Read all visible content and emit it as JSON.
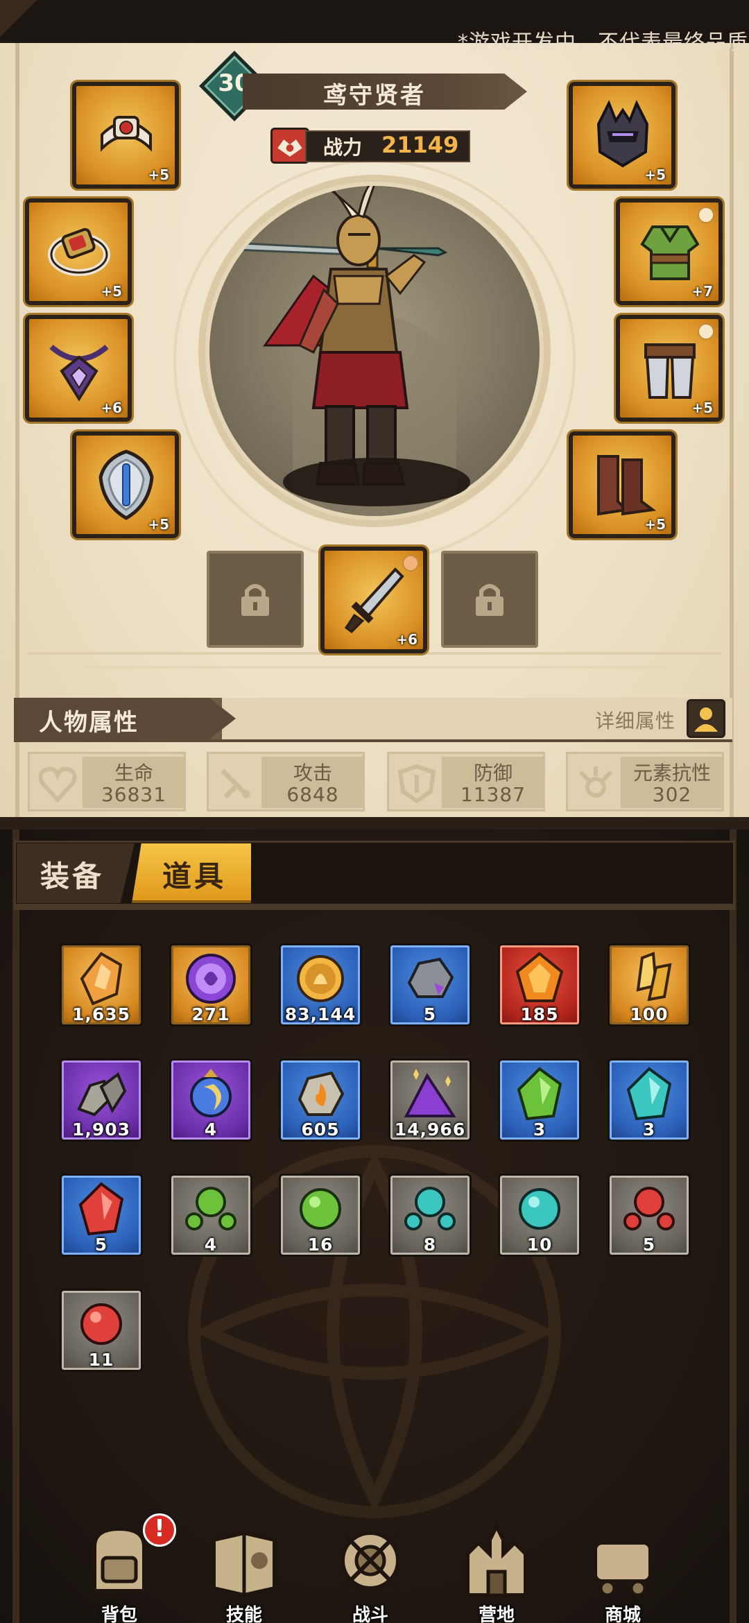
{
  "dev_note": "*游戏开发中，不代表最终品质",
  "hero": {
    "level": "30",
    "name": "鸢守贤者",
    "power_label": "战力",
    "power_value": "21149"
  },
  "equipment": {
    "ring_top": "+5",
    "ring_mid": "+5",
    "amulet": "+6",
    "shield": "+5",
    "helmet": "+5",
    "chest": "+7",
    "legs": "+5",
    "boots": "+5",
    "weapon": "+6"
  },
  "attributes": {
    "title": "人物属性",
    "detail_label": "详细属性",
    "stats": [
      {
        "label": "生命",
        "value": "36831",
        "icon": "heart-icon"
      },
      {
        "label": "攻击",
        "value": "6848",
        "icon": "sword-icon"
      },
      {
        "label": "防御",
        "value": "11387",
        "icon": "shield-icon"
      },
      {
        "label": "元素抗性",
        "value": "302",
        "icon": "element-icon"
      }
    ]
  },
  "tabs": {
    "equipment": "装备",
    "items": "道具"
  },
  "items": [
    {
      "count": "1,635",
      "rarity": "orange",
      "icon": "amber-crystal-icon"
    },
    {
      "count": "271",
      "rarity": "orange",
      "icon": "purple-orb-coin-icon"
    },
    {
      "count": "83,144",
      "rarity": "blue",
      "icon": "gold-coin-icon"
    },
    {
      "count": "5",
      "rarity": "blue",
      "icon": "ore-rock-icon"
    },
    {
      "count": "185",
      "rarity": "red",
      "icon": "fire-gem-icon"
    },
    {
      "count": "100",
      "rarity": "orange",
      "icon": "gold-shards-icon"
    },
    {
      "count": "1,903",
      "rarity": "purple",
      "icon": "stone-pile-icon"
    },
    {
      "count": "4",
      "rarity": "purple",
      "icon": "moon-orb-icon"
    },
    {
      "count": "605",
      "rarity": "blue",
      "icon": "flame-rock-icon"
    },
    {
      "count": "14,966",
      "rarity": "gray",
      "icon": "purple-dust-icon"
    },
    {
      "count": "3",
      "rarity": "blue",
      "icon": "green-crystal-icon"
    },
    {
      "count": "3",
      "rarity": "blue",
      "icon": "cyan-crystal-icon"
    },
    {
      "count": "5",
      "rarity": "blue",
      "icon": "red-crystal-icon"
    },
    {
      "count": "4",
      "rarity": "gray",
      "icon": "green-gem-cluster-icon"
    },
    {
      "count": "16",
      "rarity": "gray",
      "icon": "green-gem-icon"
    },
    {
      "count": "8",
      "rarity": "gray",
      "icon": "cyan-gem-cluster-icon"
    },
    {
      "count": "10",
      "rarity": "gray",
      "icon": "cyan-gem-icon"
    },
    {
      "count": "5",
      "rarity": "gray",
      "icon": "red-gem-cluster-icon"
    },
    {
      "count": "11",
      "rarity": "gray",
      "icon": "red-gem-icon"
    }
  ],
  "nav": [
    {
      "label": "背包",
      "icon": "backpack-icon"
    },
    {
      "label": "技能",
      "icon": "skill-book-icon"
    },
    {
      "label": "战斗",
      "icon": "battle-icon"
    },
    {
      "label": "营地",
      "icon": "camp-castle-icon"
    },
    {
      "label": "商城",
      "icon": "shop-cart-icon"
    }
  ],
  "nav_alert": "!",
  "colors": {
    "parchment": "#ede0c6",
    "dark_panel": "#201812",
    "gold_tab": "#f7c548",
    "power_value": "#f4b44a",
    "rarity_orange": "#d6861e",
    "rarity_blue": "#2b5fb6",
    "rarity_purple": "#6a2ea8",
    "rarity_red": "#b3261c",
    "rarity_gray": "#67635b"
  }
}
